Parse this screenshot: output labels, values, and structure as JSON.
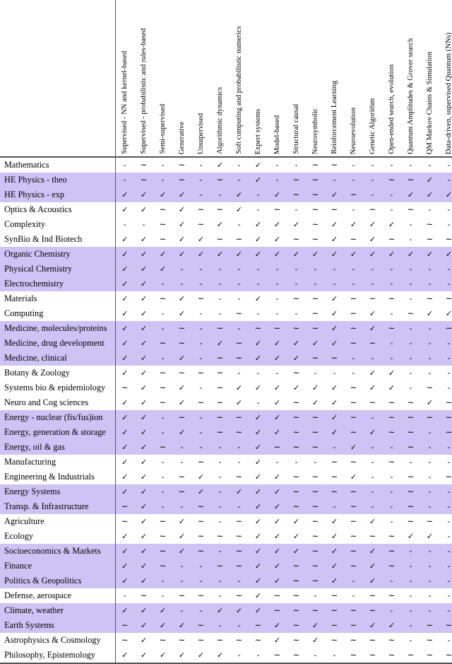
{
  "table": {
    "columns": [
      "Supervised - NN and kernel-based",
      "Supervised - probabilistic and rules-based",
      "Semi-supervised",
      "Generative",
      "Unsupervised",
      "Algorithmic dynamics",
      "Soft computing and probabilistic numerics",
      "Expert systems",
      "Model-based",
      "Structural causal",
      "Neurosymbolic",
      "Reinforcement Learning",
      "Neuroevolution",
      "Genetic Algorithm",
      "Open-ended search, evolution",
      "Quantum Amplitudes & Grover search",
      "QM Markov Chains & Simulation",
      "Data-driven, supervised Quantum (NNs)"
    ],
    "symbols": {
      "yes": "✓",
      "partial": "∼",
      "no": "-"
    },
    "colors": {
      "shaded_row": "#cfc2f5",
      "plain_row": "#ffffff",
      "rule": "#555555"
    },
    "rows": [
      {
        "label": "Mathematics",
        "shaded": false,
        "cells": [
          "-",
          "~",
          "-",
          "~",
          "-",
          "✓",
          "-",
          "✓",
          "-",
          "-",
          "~",
          "~",
          "-",
          "-",
          "-",
          "-",
          "-",
          "-"
        ]
      },
      {
        "label": "HE Physics - theo",
        "shaded": true,
        "cells": [
          "-",
          "~",
          "-",
          "~",
          "-",
          "~",
          "-",
          "✓",
          "-",
          "~",
          "~",
          "-",
          "-",
          "-",
          "~",
          "~",
          "✓",
          "-"
        ]
      },
      {
        "label": "HE Physics - exp",
        "shaded": true,
        "cells": [
          "✓",
          "✓",
          "✓",
          "✓",
          "-",
          "-",
          "✓",
          "-",
          "✓",
          "~",
          "~",
          "✓",
          "~",
          "-",
          "-",
          "✓",
          "✓",
          "✓"
        ]
      },
      {
        "label": "Optics & Acoustics",
        "shaded": false,
        "cells": [
          "✓",
          "✓",
          "~",
          "✓",
          "~",
          "~",
          "✓",
          "-",
          "~",
          "-",
          "~",
          "~",
          "-",
          "~",
          "-",
          "~",
          "-",
          "-"
        ]
      },
      {
        "label": "Complexity",
        "shaded": false,
        "cells": [
          "-",
          "-",
          "~",
          "✓",
          "~",
          "✓",
          "-",
          "✓",
          "✓",
          "✓",
          "~",
          "✓",
          "✓",
          "✓",
          "✓",
          "-",
          "~",
          "-"
        ]
      },
      {
        "label": "SynBio & Ind Biotech",
        "shaded": false,
        "cells": [
          "✓",
          "✓",
          "~",
          "✓",
          "✓",
          "~",
          "~",
          "✓",
          "✓",
          "~",
          "~",
          "✓",
          "~",
          "✓",
          "~",
          "-",
          "~",
          "~"
        ]
      },
      {
        "label": "Organic Chemistry",
        "shaded": true,
        "cells": [
          "✓",
          "✓",
          "✓",
          "✓",
          "✓",
          "✓",
          "✓",
          "✓",
          "✓",
          "✓",
          "✓",
          "✓",
          "✓",
          "✓",
          "✓",
          "✓",
          "✓",
          "✓"
        ]
      },
      {
        "label": "Physical Chemistry",
        "shaded": true,
        "cells": [
          "✓",
          "✓",
          "✓",
          "-",
          "-",
          "-",
          "-",
          "-",
          "-",
          "-",
          "-",
          "-",
          "-",
          "-",
          "-",
          "-",
          "-",
          "-"
        ]
      },
      {
        "label": "Electrochemistry",
        "shaded": true,
        "cells": [
          "✓",
          "✓",
          "-",
          "-",
          "-",
          "-",
          "-",
          "-",
          "-",
          "-",
          "-",
          "-",
          "-",
          "-",
          "-",
          "-",
          "-",
          "-"
        ]
      },
      {
        "label": "Materials",
        "shaded": false,
        "cells": [
          "✓",
          "✓",
          "~",
          "✓",
          "~",
          "-",
          "-",
          "✓",
          "-",
          "~",
          "~",
          "✓",
          "~",
          "~",
          "~",
          "-",
          "~",
          "~"
        ]
      },
      {
        "label": "Computing",
        "shaded": false,
        "cells": [
          "✓",
          "✓",
          "-",
          "✓",
          "-",
          "-",
          "~",
          "-",
          "-",
          "-",
          "~",
          "✓",
          "~",
          "✓",
          "-",
          "~",
          "✓",
          "✓"
        ]
      },
      {
        "label": "Medicine, molecules/proteins",
        "shaded": true,
        "cells": [
          "✓",
          "✓",
          "-",
          "~",
          "-",
          "~",
          "-",
          "~",
          "~",
          "~",
          "~",
          "✓",
          "~",
          "✓",
          "~",
          "-",
          "-",
          "~"
        ]
      },
      {
        "label": "Medicine, drug development",
        "shaded": true,
        "cells": [
          "✓",
          "✓",
          "~",
          "~",
          "-",
          "✓",
          "~",
          "✓",
          "✓",
          "✓",
          "✓",
          "✓",
          "~",
          "~",
          "-",
          "-",
          "-",
          "-"
        ]
      },
      {
        "label": "Medicine, clinical",
        "shaded": true,
        "cells": [
          "✓",
          "✓",
          "-",
          "✓",
          "-",
          "~",
          "~",
          "✓",
          "✓",
          "✓",
          "~",
          "~",
          "-",
          "-",
          "-",
          "-",
          "-",
          "-"
        ]
      },
      {
        "label": "Botany & Zoology",
        "shaded": false,
        "cells": [
          "✓",
          "✓",
          "~",
          "~",
          "~",
          "~",
          "-",
          "-",
          "-",
          "~",
          "-",
          "-",
          "-",
          "✓",
          "✓",
          "-",
          "-",
          "-"
        ]
      },
      {
        "label": "Systems bio & epidemiology",
        "shaded": false,
        "cells": [
          "~",
          "✓",
          "~",
          "✓",
          "-",
          "~",
          "✓",
          "✓",
          "✓",
          "✓",
          "✓",
          "✓",
          "~",
          "✓",
          "✓",
          "-",
          "~",
          "-"
        ]
      },
      {
        "label": "Neuro and Cog sciences",
        "shaded": false,
        "cells": [
          "✓",
          "✓",
          "~",
          "✓",
          "~",
          "~",
          "✓",
          "-",
          "✓",
          "~",
          "✓",
          "✓",
          "~",
          "~",
          "~",
          "~",
          "✓",
          "~"
        ]
      },
      {
        "label": "Energy - nuclear (fis/fus)ion",
        "shaded": true,
        "cells": [
          "✓",
          "✓",
          "-",
          "~",
          "-",
          "~",
          "~",
          "✓",
          "✓",
          "~",
          "~",
          "✓",
          "~",
          "-",
          "~",
          "~",
          "~",
          "~"
        ]
      },
      {
        "label": "Energy, generation & storage",
        "shaded": true,
        "cells": [
          "✓",
          "✓",
          "-",
          "✓",
          "-",
          "~",
          "~",
          "✓",
          "✓",
          "~",
          "~",
          "✓",
          "~",
          "✓",
          "~",
          "~",
          "-",
          "~"
        ]
      },
      {
        "label": "Energy, oil & gas",
        "shaded": true,
        "cells": [
          "✓",
          "✓",
          "~",
          "-",
          "-",
          "-",
          "-",
          "✓",
          "~",
          "~",
          "~",
          "-",
          "✓",
          "-",
          "-",
          "~",
          "-",
          "-"
        ]
      },
      {
        "label": "Manufacturing",
        "shaded": false,
        "cells": [
          "✓",
          "✓",
          "-",
          "-",
          "~",
          "-",
          "-",
          "✓",
          "-",
          "-",
          "-",
          "~",
          "~",
          "-",
          "~",
          "-",
          "-",
          "-"
        ]
      },
      {
        "label": "Engineering & Industrials",
        "shaded": false,
        "cells": [
          "✓",
          "✓",
          "-",
          "~",
          "✓",
          "-",
          "~",
          "✓",
          "✓",
          "~",
          "~",
          "~",
          "✓",
          "-",
          "-",
          "~",
          "-",
          "~"
        ]
      },
      {
        "label": "Energy Systems",
        "shaded": true,
        "cells": [
          "✓",
          "✓",
          "-",
          "~",
          "✓",
          "-",
          "✓",
          "✓",
          "✓",
          "~",
          "~",
          "~",
          "~",
          "-",
          "-",
          "~",
          "-",
          "-"
        ]
      },
      {
        "label": "Transp. & Infrastructure",
        "shaded": true,
        "cells": [
          "~",
          "✓",
          "-",
          "-",
          "~",
          "-",
          "-",
          "✓",
          "✓",
          "~",
          "~",
          "-",
          "~",
          "-",
          "-",
          "~",
          "-",
          "-"
        ]
      },
      {
        "label": "Agriculture",
        "shaded": false,
        "cells": [
          "~",
          "✓",
          "~",
          "✓",
          "~",
          "-",
          "~",
          "✓",
          "✓",
          "✓",
          "~",
          "✓",
          "~",
          "✓",
          "-",
          "~",
          "~",
          "-"
        ]
      },
      {
        "label": "Ecology",
        "shaded": false,
        "cells": [
          "✓",
          "✓",
          "~",
          "✓",
          "~",
          "~",
          "~",
          "✓",
          "✓",
          "✓",
          "~",
          "✓",
          "~",
          "~",
          "~",
          "✓",
          "✓",
          "-"
        ]
      },
      {
        "label": "Socioeconomics & Markets",
        "shaded": true,
        "cells": [
          "✓",
          "✓",
          "~",
          "✓",
          "~",
          "-",
          "~",
          "✓",
          "✓",
          "✓",
          "~",
          "✓",
          "~",
          "✓",
          "~",
          "-",
          "-",
          "-"
        ]
      },
      {
        "label": "Finance",
        "shaded": true,
        "cells": [
          "✓",
          "✓",
          "~",
          "-",
          "-",
          "~",
          "~",
          "✓",
          "✓",
          "~",
          "~",
          "✓",
          "~",
          "✓",
          "~",
          "-",
          "-",
          "-"
        ]
      },
      {
        "label": "Politics & Geopolitics",
        "shaded": true,
        "cells": [
          "✓",
          "✓",
          "-",
          "-",
          "-",
          "-",
          "-",
          "✓",
          "✓",
          "~",
          "~",
          "✓",
          "-",
          "✓",
          "-",
          "-",
          "-",
          "-"
        ]
      },
      {
        "label": "Defense, aerospace",
        "shaded": false,
        "cells": [
          "-",
          "~",
          "-",
          "~",
          "~",
          "-",
          "~",
          "✓",
          "~",
          "~",
          "-",
          "~",
          "-",
          "~",
          "~",
          "-",
          "-",
          "-"
        ]
      },
      {
        "label": "Climate, weather",
        "shaded": true,
        "cells": [
          "✓",
          "✓",
          "✓",
          "-",
          "-",
          "✓",
          "✓",
          "✓",
          "~",
          "~",
          "~",
          "~",
          "~",
          "~",
          "-",
          "-",
          "-",
          "-"
        ]
      },
      {
        "label": "Earth Systems",
        "shaded": true,
        "cells": [
          "~",
          "✓",
          "✓",
          "✓",
          "~",
          "-",
          "-",
          "~",
          "✓",
          "~",
          "✓",
          "~",
          "~",
          "✓",
          "✓",
          "-",
          "~",
          "~"
        ]
      },
      {
        "label": "Astrophysics & Cosmology",
        "shaded": false,
        "cells": [
          "~",
          "✓",
          "~",
          "~",
          "~",
          "~",
          "~",
          "~",
          "✓",
          "~",
          "✓",
          "~",
          "~",
          "~",
          "~",
          "-",
          "~",
          "-"
        ]
      },
      {
        "label": "Philosophy, Epistemology",
        "shaded": false,
        "cells": [
          "✓",
          "✓",
          "✓",
          "✓",
          "✓",
          "✓",
          "-",
          "-",
          "~",
          "~",
          "-",
          "-",
          "~",
          "~",
          "~",
          "~",
          "~",
          "~"
        ]
      }
    ]
  }
}
